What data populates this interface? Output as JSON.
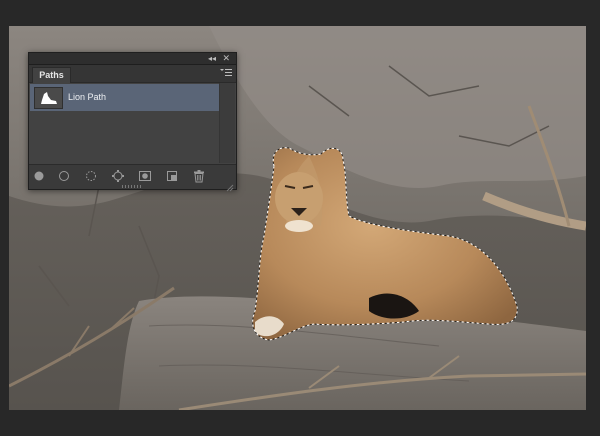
{
  "panel": {
    "collapse_glyph": "◂◂",
    "close_glyph": "✕",
    "tab_label": "Paths",
    "menu_icon": "panel-menu-icon",
    "paths": [
      {
        "name": "Lion Path",
        "selected": true
      }
    ],
    "footer_icons": [
      "fill-path-icon",
      "stroke-path-icon",
      "load-selection-icon",
      "make-work-path-icon",
      "add-mask-icon",
      "new-path-icon",
      "delete-path-icon"
    ]
  },
  "colors": {
    "selection_highlight": "#5a6577",
    "panel_bg": "#424242",
    "app_bg": "#282828"
  }
}
